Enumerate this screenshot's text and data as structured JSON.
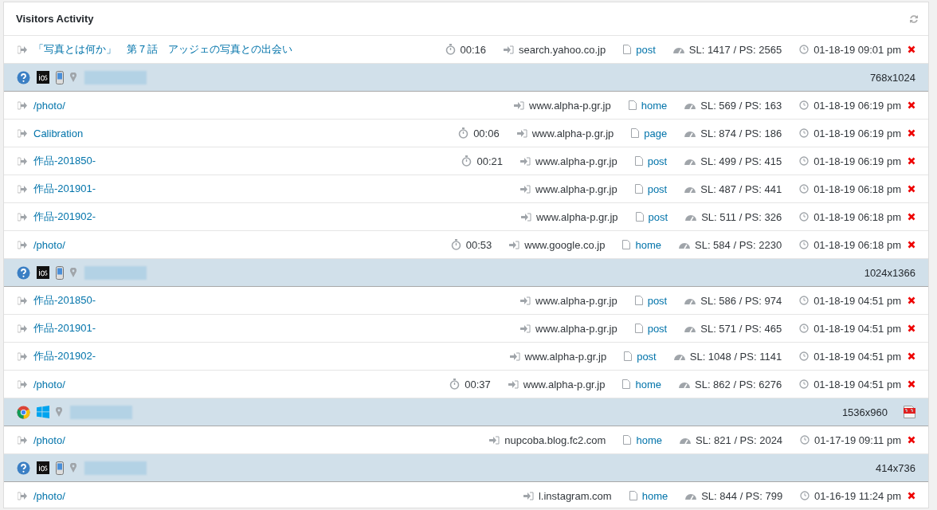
{
  "panel": {
    "title": "Visitors Activity"
  },
  "rows": [
    {
      "kind": "page",
      "title": "「写真とは何か」　第７話　アッジェの写真との出会い",
      "duration": "00:16",
      "referrer": "search.yahoo.co.jp",
      "page_type": "post",
      "stats": "SL: 1417 / PS: 2565",
      "time": "01-18-19 09:01 pm"
    },
    {
      "kind": "visitor",
      "icons": [
        {
          "kind": "unknown"
        },
        {
          "kind": "ios"
        },
        {
          "kind": "mobile"
        }
      ],
      "resolution": "768x1024",
      "pdf": false
    },
    {
      "kind": "page",
      "title": "/photo/",
      "referrer": "www.alpha-p.gr.jp",
      "page_type": "home",
      "stats": "SL: 569 / PS: 163",
      "time": "01-18-19 06:19 pm"
    },
    {
      "kind": "page",
      "title": "Calibration",
      "duration": "00:06",
      "referrer": "www.alpha-p.gr.jp",
      "page_type": "page",
      "stats": "SL: 874 / PS: 186",
      "time": "01-18-19 06:19 pm"
    },
    {
      "kind": "page",
      "title": "作品-201850-",
      "duration": "00:21",
      "referrer": "www.alpha-p.gr.jp",
      "page_type": "post",
      "stats": "SL: 499 / PS: 415",
      "time": "01-18-19 06:19 pm"
    },
    {
      "kind": "page",
      "title": "作品-201901-",
      "referrer": "www.alpha-p.gr.jp",
      "page_type": "post",
      "stats": "SL: 487 / PS: 441",
      "time": "01-18-19 06:18 pm"
    },
    {
      "kind": "page",
      "title": "作品-201902-",
      "referrer": "www.alpha-p.gr.jp",
      "page_type": "post",
      "stats": "SL: 511 / PS: 326",
      "time": "01-18-19 06:18 pm"
    },
    {
      "kind": "page",
      "title": "/photo/",
      "duration": "00:53",
      "referrer": "www.google.co.jp",
      "page_type": "home",
      "stats": "SL: 584 / PS: 2230",
      "time": "01-18-19 06:18 pm"
    },
    {
      "kind": "visitor",
      "icons": [
        {
          "kind": "unknown"
        },
        {
          "kind": "ios"
        },
        {
          "kind": "mobile"
        }
      ],
      "resolution": "1024x1366",
      "pdf": false
    },
    {
      "kind": "page",
      "title": "作品-201850-",
      "referrer": "www.alpha-p.gr.jp",
      "page_type": "post",
      "stats": "SL: 586 / PS: 974",
      "time": "01-18-19 04:51 pm"
    },
    {
      "kind": "page",
      "title": "作品-201901-",
      "referrer": "www.alpha-p.gr.jp",
      "page_type": "post",
      "stats": "SL: 571 / PS: 465",
      "time": "01-18-19 04:51 pm"
    },
    {
      "kind": "page",
      "title": "作品-201902-",
      "referrer": "www.alpha-p.gr.jp",
      "page_type": "post",
      "stats": "SL: 1048 / PS: 1141",
      "time": "01-18-19 04:51 pm"
    },
    {
      "kind": "page",
      "title": "/photo/",
      "duration": "00:37",
      "referrer": "www.alpha-p.gr.jp",
      "page_type": "home",
      "stats": "SL: 862 / PS: 6276",
      "time": "01-18-19 04:51 pm"
    },
    {
      "kind": "visitor",
      "icons": [
        {
          "kind": "chrome"
        },
        {
          "kind": "windows"
        }
      ],
      "resolution": "1536x960",
      "pdf": true
    },
    {
      "kind": "page",
      "title": "/photo/",
      "referrer": "nupcoba.blog.fc2.com",
      "page_type": "home",
      "stats": "SL: 821 / PS: 2024",
      "time": "01-17-19 09:11 pm"
    },
    {
      "kind": "visitor",
      "icons": [
        {
          "kind": "unknown"
        },
        {
          "kind": "ios"
        },
        {
          "kind": "mobile"
        }
      ],
      "resolution": "414x736",
      "pdf": false
    },
    {
      "kind": "page",
      "title": "/photo/",
      "referrer": "l.instagram.com",
      "page_type": "home",
      "stats": "SL: 844 / PS: 799",
      "time": "01-16-19 11:24 pm"
    }
  ]
}
